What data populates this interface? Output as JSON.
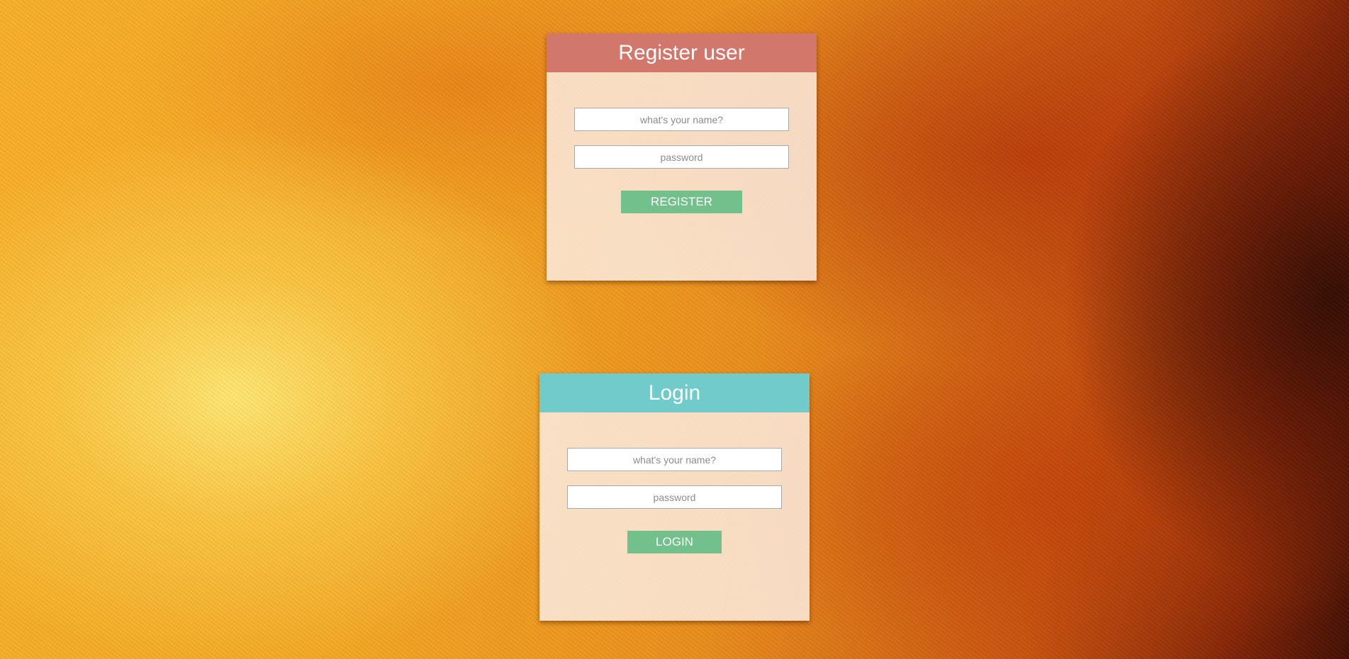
{
  "register": {
    "title": "Register user",
    "name_placeholder": "what's your name?",
    "password_placeholder": "password",
    "button_label": "REGISTER"
  },
  "login": {
    "title": "Login",
    "name_placeholder": "what's your name?",
    "password_placeholder": "password",
    "button_label": "LOGIN"
  },
  "colors": {
    "register_header": "#d1776c",
    "login_header": "#72cbcb",
    "button": "#72c08b",
    "panel_background": "#fae8da"
  }
}
